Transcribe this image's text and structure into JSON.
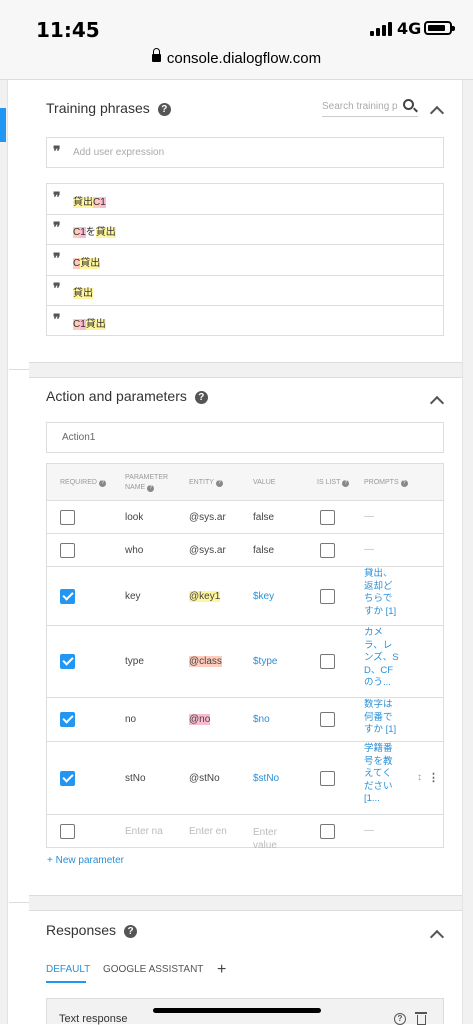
{
  "status_bar": {
    "time": "11:45",
    "network": "4G",
    "battery_level": 0.85
  },
  "browser": {
    "url": "console.dialogflow.com"
  },
  "training_phrases": {
    "title": "Training phrases",
    "search_placeholder": "Search training p",
    "add_placeholder": "Add user expression",
    "phrases": [
      {
        "parts": [
          {
            "text": "貸出",
            "hl": "y"
          },
          {
            "text": "C",
            "hl": "o"
          },
          {
            "text": "1",
            "hl": "p"
          }
        ]
      },
      {
        "parts": [
          {
            "text": "C",
            "hl": "o"
          },
          {
            "text": "1",
            "hl": "p"
          },
          {
            "text": "を",
            "hl": ""
          },
          {
            "text": "貸出",
            "hl": "y"
          }
        ]
      },
      {
        "parts": [
          {
            "text": "C",
            "hl": "o"
          },
          {
            "text": "貸出",
            "hl": "y"
          }
        ]
      },
      {
        "parts": [
          {
            "text": "貸出",
            "hl": "y"
          }
        ]
      },
      {
        "parts": [
          {
            "text": "C",
            "hl": "o"
          },
          {
            "text": "1",
            "hl": "p"
          },
          {
            "text": "貸出",
            "hl": "y"
          }
        ]
      }
    ]
  },
  "action": {
    "title": "Action and parameters",
    "action_name": "Action1",
    "headers": {
      "required": "REQUIRED",
      "param_name_1": "PARAMETER",
      "param_name_2": "NAME",
      "entity": "ENTITY",
      "value": "VALUE",
      "is_list": "IS LIST",
      "prompts": "PROMPTS"
    },
    "rows": [
      {
        "required": false,
        "name": "look",
        "entity": "@sys.ar",
        "value": "false",
        "is_list": false,
        "prompts": "—"
      },
      {
        "required": false,
        "name": "who",
        "entity": "@sys.ar",
        "value": "false",
        "is_list": false,
        "prompts": "—"
      },
      {
        "required": true,
        "name": "key",
        "entity": "@key1",
        "value": "$key",
        "is_list": false,
        "prompts": "貸出、返却どちらですか [1]"
      },
      {
        "required": true,
        "name": "type",
        "entity": "@class",
        "value": "$type",
        "is_list": false,
        "prompts": "カメラ、レンズ、SD、CFのう..."
      },
      {
        "required": true,
        "name": "no",
        "entity": "@no",
        "value": "$no",
        "is_list": false,
        "prompts": "数字は何番ですか [1]"
      },
      {
        "required": true,
        "name": "stNo",
        "entity": "@stNo",
        "value": "$stNo",
        "is_list": false,
        "prompts": "学籍番号を教えてください [1..."
      }
    ],
    "empty_row": {
      "name_placeholder": "Enter na",
      "entity_placeholder": "Enter en",
      "value_placeholder": "Enter value",
      "prompts": "—"
    },
    "new_parameter": "+ New parameter"
  },
  "responses": {
    "title": "Responses",
    "tabs": [
      "DEFAULT",
      "GOOGLE ASSISTANT"
    ],
    "add_tab": "+",
    "text_response": "Text response"
  },
  "colors": {
    "accent": "#2196f3",
    "link": "#2a90d8",
    "highlight_yellow": "#fff59d",
    "highlight_orange": "#ffccbc",
    "highlight_pink": "#f8bbd0"
  }
}
